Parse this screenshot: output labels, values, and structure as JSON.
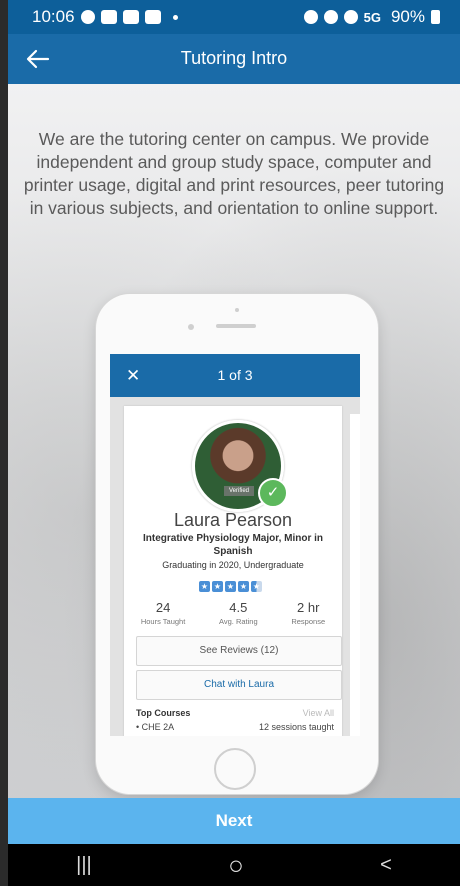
{
  "status_bar": {
    "time": "10:06",
    "network": "5G",
    "battery": "90%"
  },
  "app_bar": {
    "title": "Tutoring Intro",
    "back_icon": "arrow-left-icon"
  },
  "intro_text": "We are the tutoring center on campus. We provide independent and group study space, computer and printer usage, digital and print resources, peer tutoring in various subjects, and orientation to online support.",
  "mockup": {
    "pager": "1 of 3",
    "close_icon": "close-icon",
    "tutor": {
      "verified_label": "Verified",
      "name": "Laura Pearson",
      "major": "Integrative Physiology Major, Minor in Spanish",
      "graduating": "Graduating in 2020, Undergraduate",
      "rating_stars": 4.5,
      "stats": [
        {
          "value": "24",
          "label": "Hours Taught"
        },
        {
          "value": "4.5",
          "label": "Avg. Rating"
        },
        {
          "value": "2 hr",
          "label": "Response"
        }
      ],
      "see_reviews": "See Reviews (12)",
      "chat": "Chat with Laura",
      "top_courses_label": "Top Courses",
      "view_all": "View All",
      "course": {
        "name": "• CHE 2A",
        "sessions": "12 sessions taught"
      }
    }
  },
  "next_label": "Next",
  "nav_bar": {
    "recents": "|||",
    "home": "○",
    "back": "<"
  },
  "colors": {
    "app_bar": "#1a6ba8",
    "status_bar": "#0d5f9a",
    "next_button": "#5bb4ee"
  }
}
